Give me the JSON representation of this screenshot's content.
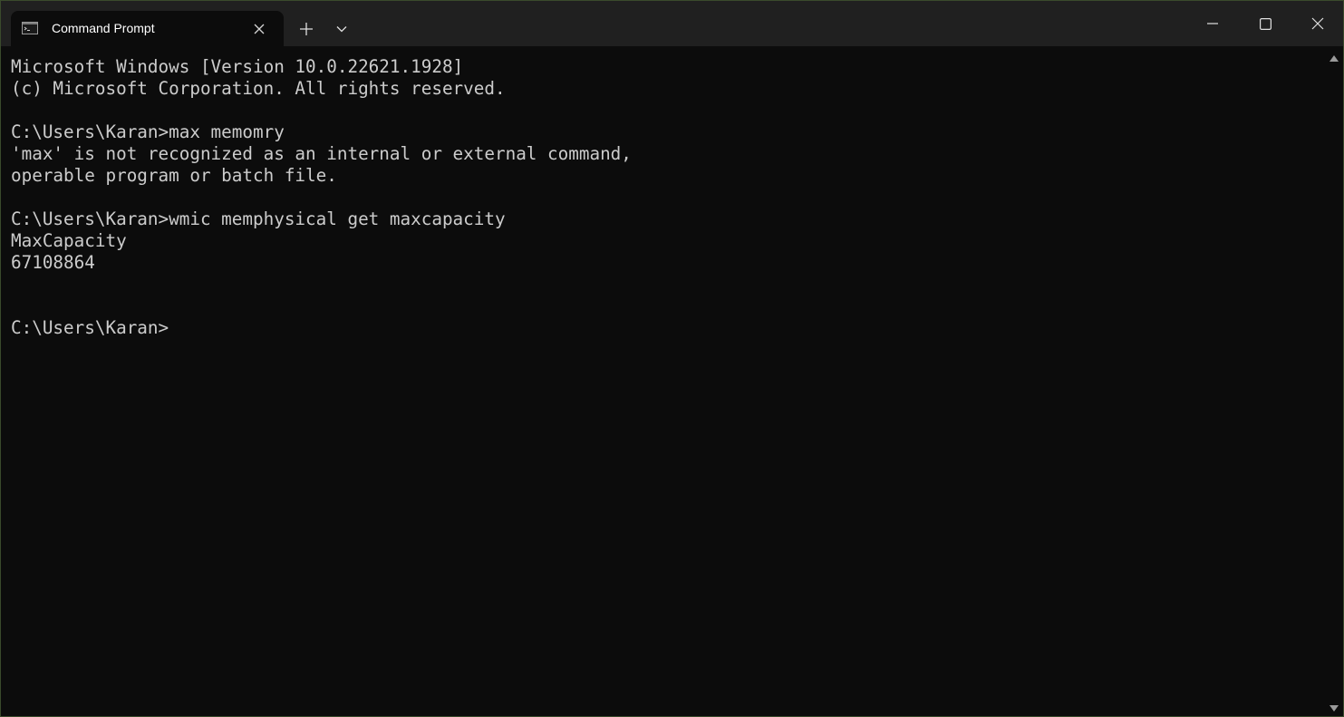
{
  "window": {
    "tab_title": "Command Prompt"
  },
  "icons": {
    "tab": "terminal-icon",
    "tab_close": "close-icon",
    "new_tab": "plus-icon",
    "dropdown": "chevron-down-icon",
    "minimize": "minimize-icon",
    "maximize": "maximize-icon",
    "close": "close-icon",
    "scroll_up": "triangle-up-icon",
    "scroll_down": "triangle-down-icon"
  },
  "colors": {
    "titlebar": "#202020",
    "terminal_bg": "#0c0c0c",
    "terminal_text": "#cccccc"
  },
  "terminal": {
    "lines": [
      "Microsoft Windows [Version 10.0.22621.1928]",
      "(c) Microsoft Corporation. All rights reserved.",
      "",
      "C:\\Users\\Karan>max memomry",
      "'max' is not recognized as an internal or external command,",
      "operable program or batch file.",
      "",
      "C:\\Users\\Karan>wmic memphysical get maxcapacity",
      "MaxCapacity",
      "67108864",
      "",
      "C:\\Users\\Karan>"
    ]
  }
}
